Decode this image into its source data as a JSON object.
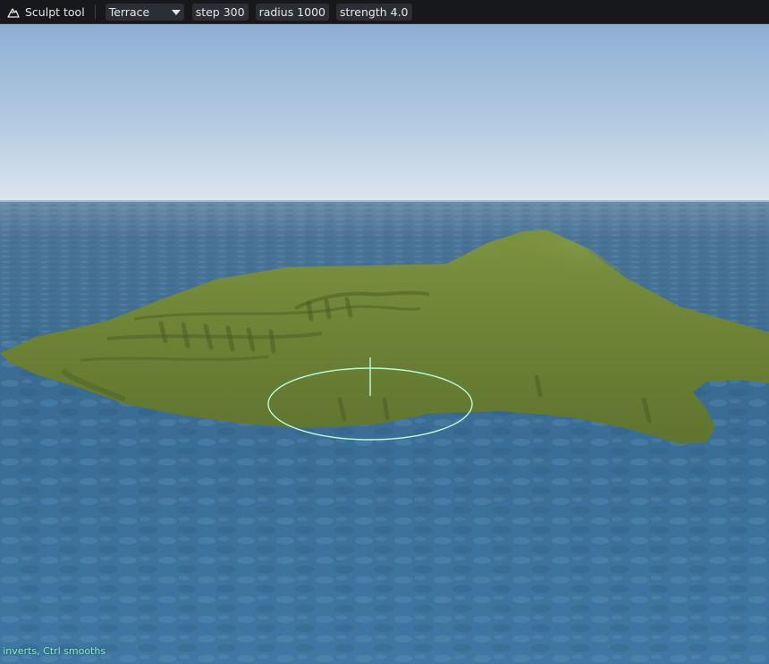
{
  "toolbar": {
    "tool_icon": "mountain-icon",
    "tool_title": "Sculpt tool",
    "brush_mode": {
      "selected": "Terrace"
    },
    "step": "step 300",
    "radius": "radius 1000",
    "strength": "strength 4.0"
  },
  "status": {
    "hint": ": inverts, Ctrl smooths"
  },
  "colors": {
    "toolbar_bg": "#17181c",
    "chip_bg": "#2b2e35",
    "brush_ring": "#b8ffd8",
    "hint_text": "#8df0c4",
    "terrain": "#6e8535",
    "water": "#3a6e98",
    "sky_top": "#8fb1d6"
  }
}
